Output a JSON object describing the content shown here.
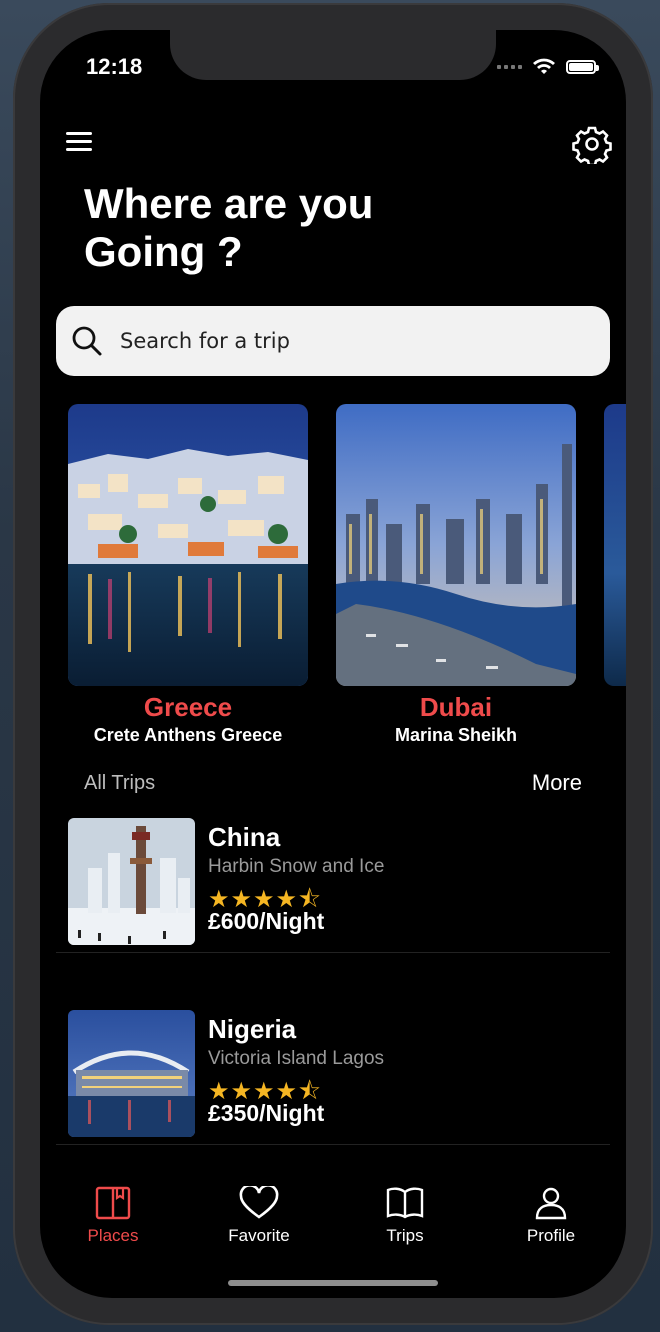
{
  "status": {
    "time": "12:18"
  },
  "header": {
    "title": "Where are you Going ?"
  },
  "search": {
    "placeholder": "Search for a trip"
  },
  "featured": [
    {
      "name": "Greece",
      "subtitle": "Crete Anthens Greece"
    },
    {
      "name": "Dubai",
      "subtitle": "Marina Sheikh"
    }
  ],
  "section": {
    "all_trips": "All Trips",
    "more": "More"
  },
  "trips": [
    {
      "name": "China",
      "subtitle": "Harbin Snow and Ice",
      "rating": 4.5,
      "price": "£600/Night"
    },
    {
      "name": "Nigeria",
      "subtitle": "Victoria Island Lagos",
      "rating": 4.5,
      "price": "£350/Night"
    }
  ],
  "tabs": [
    {
      "label": "Places",
      "icon": "book-icon",
      "active": true
    },
    {
      "label": "Favorite",
      "icon": "heart-icon",
      "active": false
    },
    {
      "label": "Trips",
      "icon": "open-book-icon",
      "active": false
    },
    {
      "label": "Profile",
      "icon": "person-icon",
      "active": false
    }
  ],
  "colors": {
    "accent": "#ef4b4b",
    "star": "#f5b623",
    "background": "#000000"
  }
}
